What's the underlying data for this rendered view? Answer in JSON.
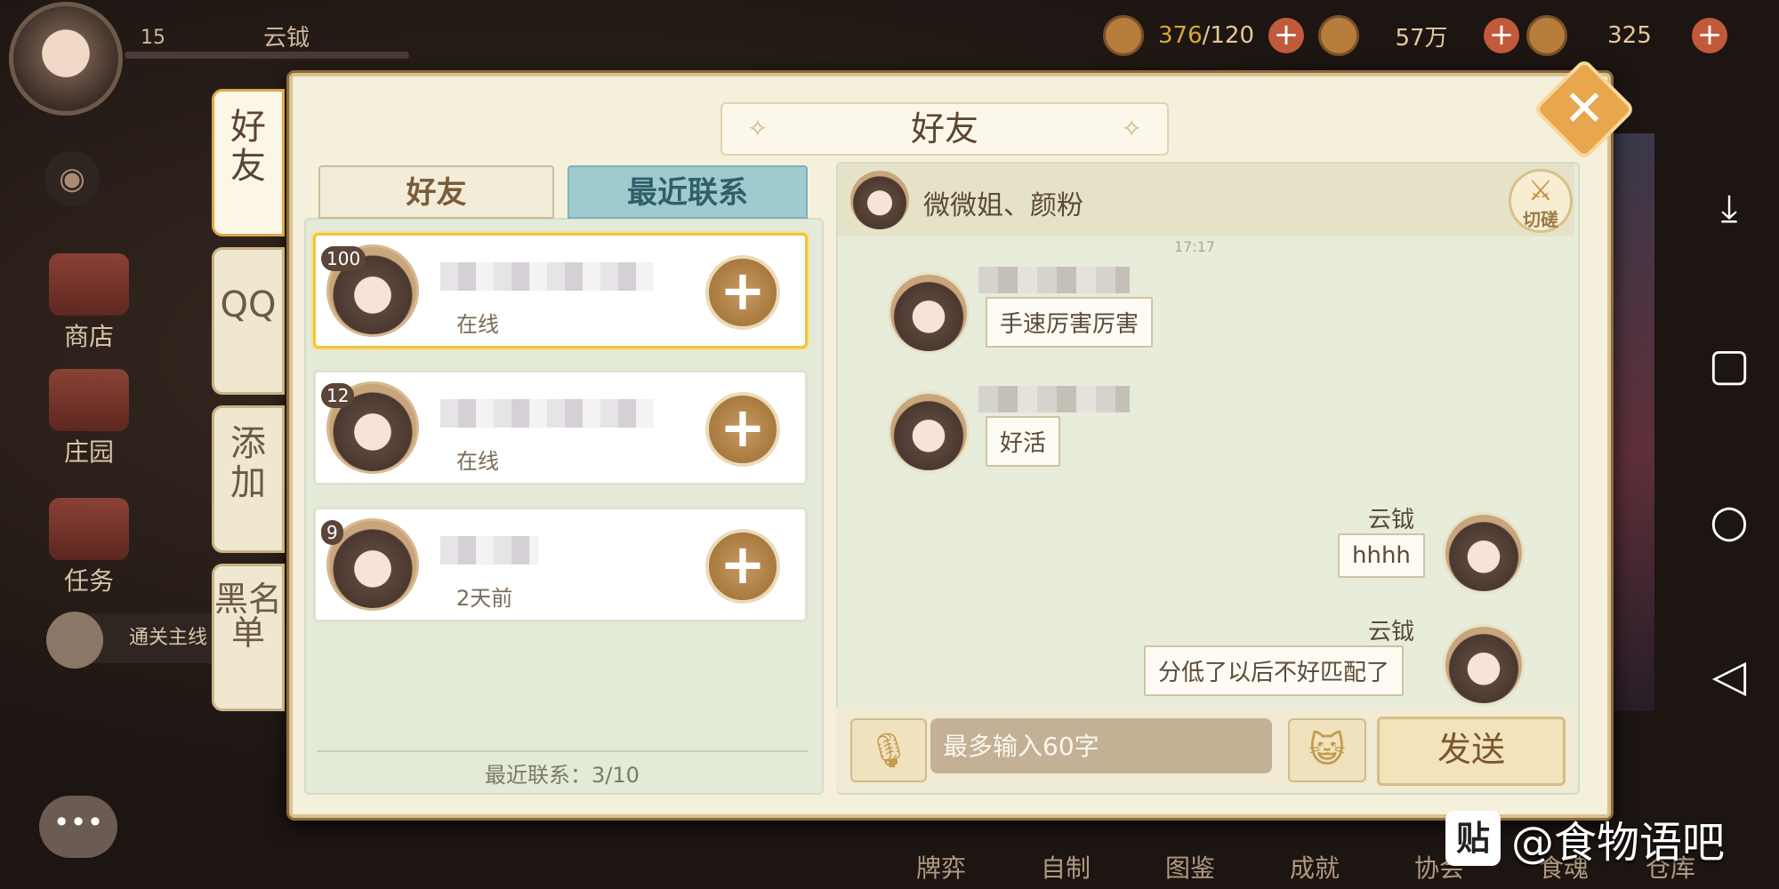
{
  "top": {
    "level": "15",
    "player_name": "云钺",
    "resources": [
      {
        "name": "stamina",
        "current": "376",
        "max": "/120"
      },
      {
        "name": "gold",
        "value": "57万"
      },
      {
        "name": "diamonds",
        "value": "325"
      }
    ],
    "plus": "+"
  },
  "game_menu": {
    "shop": "商店",
    "manor": "庄园",
    "tasks": "任务",
    "quest_chip": "通关主线",
    "bottom": [
      "牌弈",
      "自制",
      "图鉴",
      "成就",
      "协会",
      "食魂",
      "仓库"
    ]
  },
  "modal": {
    "title": "好友",
    "close": "✕",
    "side_tabs": [
      {
        "label": "好友",
        "active": true
      },
      {
        "label": "QQ",
        "active": false
      },
      {
        "label": "添加",
        "active": false
      },
      {
        "label": "黑名单",
        "active": false
      }
    ],
    "tabs": {
      "friends": "好友",
      "recent": "最近联系",
      "active": "recent"
    },
    "friends": [
      {
        "level": "100",
        "status": "在线",
        "selected": true
      },
      {
        "level": "12",
        "status": "在线",
        "selected": false
      },
      {
        "level": "9",
        "status": "2天前",
        "selected": false
      }
    ],
    "add_symbol": "+",
    "footer": "最近联系：3/10"
  },
  "chat": {
    "title": "微微姐、颜粉",
    "duel_label": "切磋",
    "timestamp": "17:17",
    "messages": [
      {
        "from": "other",
        "text": "手速厉害厉害"
      },
      {
        "from": "other",
        "text": "好活"
      },
      {
        "from": "self",
        "sender": "云钺",
        "text": "hhhh"
      },
      {
        "from": "self",
        "sender": "云钺",
        "text": "分低了以后不好匹配了"
      }
    ],
    "input_placeholder": "最多输入60字",
    "send_label": "发送"
  },
  "watermark": {
    "logo": "贴",
    "text": "@食物语吧"
  },
  "colors": {
    "accent_gold": "#d9a94b",
    "tab_active": "#9fcbd0",
    "panel_bg": "#f5f0dc"
  }
}
